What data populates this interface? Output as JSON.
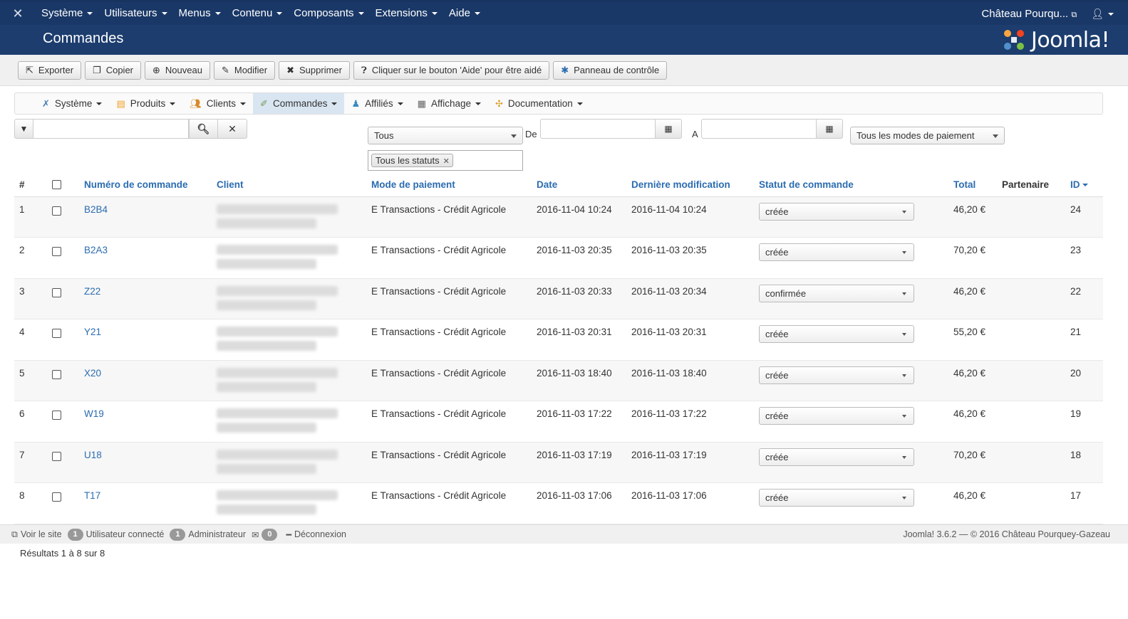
{
  "topnav": {
    "menu": [
      "Système",
      "Utilisateurs",
      "Menus",
      "Contenu",
      "Composants",
      "Extensions",
      "Aide"
    ],
    "site_name": "Château Pourqu...",
    "user_icon": "user-icon"
  },
  "header": {
    "title": "Commandes",
    "brand": "Joomla!"
  },
  "toolbar": {
    "export": "Exporter",
    "copy": "Copier",
    "new": "Nouveau",
    "edit": "Modifier",
    "delete": "Supprimer",
    "help": "Cliquer sur le bouton 'Aide' pour être aidé",
    "control_panel": "Panneau de contrôle"
  },
  "submenu": {
    "system": "Système",
    "products": "Produits",
    "clients": "Clients",
    "orders": "Commandes",
    "affiliates": "Affiliés",
    "display": "Affichage",
    "documentation": "Documentation"
  },
  "filters": {
    "search_value": "",
    "type": "Tous",
    "from_label": "De",
    "to_label": "A",
    "payment_mode": "Tous les modes de paiement",
    "status_tag": "Tous les statuts"
  },
  "table": {
    "headers": {
      "num": "#",
      "order_number": "Numéro de commande",
      "client": "Client",
      "payment": "Mode de paiement",
      "date": "Date",
      "modified": "Dernière modification",
      "status": "Statut de commande",
      "total": "Total",
      "partner": "Partenaire",
      "id": "ID"
    },
    "rows": [
      {
        "n": "1",
        "order": "B2B4",
        "payment": "E Transactions - Crédit Agricole",
        "date": "2016-11-04 10:24",
        "modified": "2016-11-04 10:24",
        "status": "créée",
        "total": "46,20 €",
        "id": "24"
      },
      {
        "n": "2",
        "order": "B2A3",
        "payment": "E Transactions - Crédit Agricole",
        "date": "2016-11-03 20:35",
        "modified": "2016-11-03 20:35",
        "status": "créée",
        "total": "70,20 €",
        "id": "23"
      },
      {
        "n": "3",
        "order": "Z22",
        "payment": "E Transactions - Crédit Agricole",
        "date": "2016-11-03 20:33",
        "modified": "2016-11-03 20:34",
        "status": "confirmée",
        "total": "46,20 €",
        "id": "22"
      },
      {
        "n": "4",
        "order": "Y21",
        "payment": "E Transactions - Crédit Agricole",
        "date": "2016-11-03 20:31",
        "modified": "2016-11-03 20:31",
        "status": "créée",
        "total": "55,20 €",
        "id": "21"
      },
      {
        "n": "5",
        "order": "X20",
        "payment": "E Transactions - Crédit Agricole",
        "date": "2016-11-03 18:40",
        "modified": "2016-11-03 18:40",
        "status": "créée",
        "total": "46,20 €",
        "id": "20"
      },
      {
        "n": "6",
        "order": "W19",
        "payment": "E Transactions - Crédit Agricole",
        "date": "2016-11-03 17:22",
        "modified": "2016-11-03 17:22",
        "status": "créée",
        "total": "46,20 €",
        "id": "19"
      },
      {
        "n": "7",
        "order": "U18",
        "payment": "E Transactions - Crédit Agricole",
        "date": "2016-11-03 17:19",
        "modified": "2016-11-03 17:19",
        "status": "créée",
        "total": "70,20 €",
        "id": "18"
      },
      {
        "n": "8",
        "order": "T17",
        "payment": "E Transactions - Crédit Agricole",
        "date": "2016-11-03 17:06",
        "modified": "2016-11-03 17:06",
        "status": "créée",
        "total": "46,20 €",
        "id": "17"
      }
    ]
  },
  "footer": {
    "view_site": "Voir le site",
    "users_count": "1",
    "users_label": "Utilisateur connecté",
    "admin_count": "1",
    "admin_label": "Administrateur",
    "messages_count": "0",
    "logout": "Déconnexion",
    "copyright": "Joomla! 3.6.2 — © 2016 Château Pourquey-Gazeau"
  },
  "results": "Résultats 1 à 8 sur 8",
  "colors": {
    "nav_bg": "#1a3867",
    "header_bg": "#1c3d6e",
    "link": "#2b6cb0",
    "active_tab": "#d9e6f2"
  }
}
